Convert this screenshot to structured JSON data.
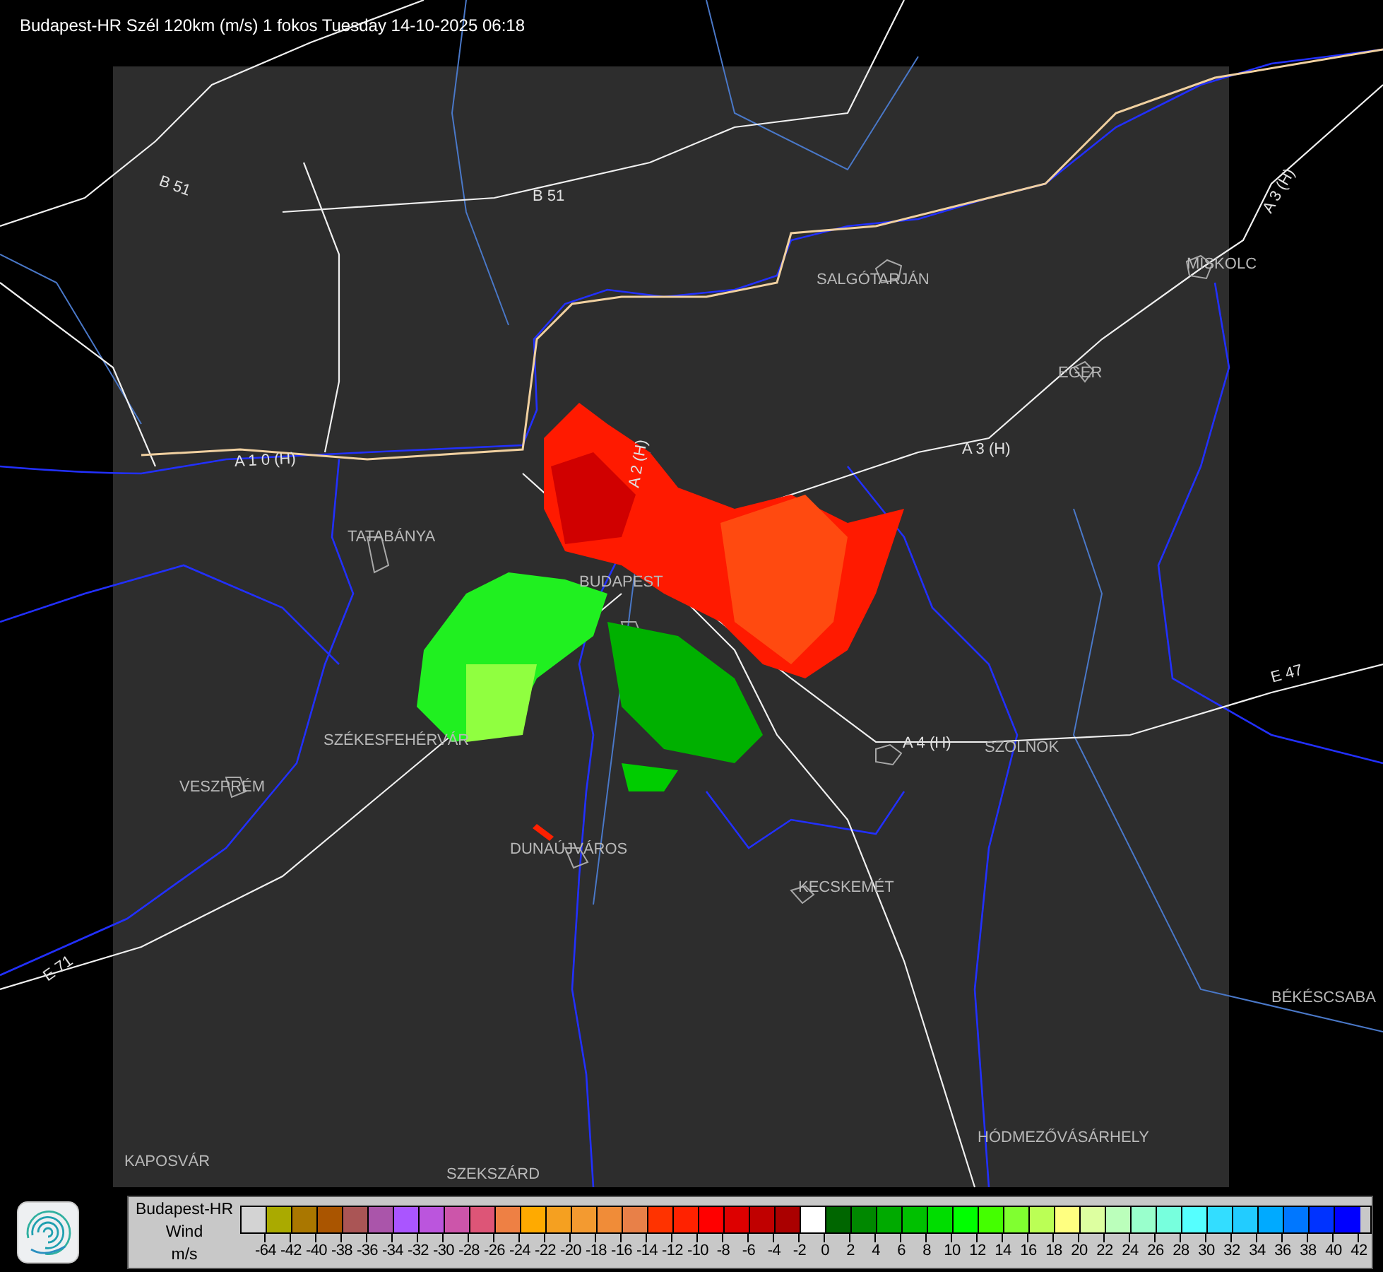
{
  "title": "Budapest-HR Szél 120km (m/s) 1 fokos Tuesday 14-10-2025 06:18",
  "map_labels": [
    {
      "kind": "road",
      "text": "B 51"
    },
    {
      "kind": "road",
      "text": "B 51"
    },
    {
      "kind": "city",
      "text": "SALGÓTARJÁN"
    },
    {
      "kind": "city",
      "text": "MISKOLC"
    },
    {
      "kind": "road",
      "text": "A 3 (H)"
    },
    {
      "kind": "road",
      "text": "A 3 (H)"
    },
    {
      "kind": "city",
      "text": "EGER"
    },
    {
      "kind": "road",
      "text": "A 1 0 (H)"
    },
    {
      "kind": "road",
      "text": "A 2 (H)"
    },
    {
      "kind": "city",
      "text": "TATABÁNYA"
    },
    {
      "kind": "city",
      "text": "BUDAPEST"
    },
    {
      "kind": "city",
      "text": "SZÉKESFEHÉRVÁR"
    },
    {
      "kind": "road",
      "text": "A 4 (H)"
    },
    {
      "kind": "city",
      "text": "SZOLNOK"
    },
    {
      "kind": "road",
      "text": "E 47"
    },
    {
      "kind": "city",
      "text": "VESZPRÉM"
    },
    {
      "kind": "city",
      "text": "DUNAÚJVÁROS"
    },
    {
      "kind": "city",
      "text": "KECSKEMÉT"
    },
    {
      "kind": "road",
      "text": "E 71"
    },
    {
      "kind": "city",
      "text": "BÉKÉSCSABA"
    },
    {
      "kind": "city",
      "text": "HÓDMEZŐVÁSÁRHELY"
    },
    {
      "kind": "city",
      "text": "KAPOSVÁR"
    },
    {
      "kind": "city",
      "text": "SZEKSZÁRD"
    }
  ],
  "legend": {
    "lines": [
      "Budapest-HR",
      "Wind",
      "m/s"
    ],
    "scale": [
      {
        "color": "#d3d3d3",
        "label": "-64"
      },
      {
        "color": "#aaaa00",
        "label": "-42"
      },
      {
        "color": "#aa7700",
        "label": "-40"
      },
      {
        "color": "#aa5500",
        "label": "-38"
      },
      {
        "color": "#aa5555",
        "label": "-36"
      },
      {
        "color": "#aa55aa",
        "label": "-34"
      },
      {
        "color": "#aa55ff",
        "label": "-32"
      },
      {
        "color": "#bb55dd",
        "label": "-30"
      },
      {
        "color": "#cc55aa",
        "label": "-28"
      },
      {
        "color": "#dd5577",
        "label": "-26"
      },
      {
        "color": "#ee8044",
        "label": "-24"
      },
      {
        "color": "#ffaa00",
        "label": "-22"
      },
      {
        "color": "#f5a020",
        "label": "-20"
      },
      {
        "color": "#f39a30",
        "label": "-18"
      },
      {
        "color": "#f08c38",
        "label": "-16"
      },
      {
        "color": "#e88048",
        "label": "-14"
      },
      {
        "color": "#ff3300",
        "label": "-12"
      },
      {
        "color": "#ff2200",
        "label": "-10"
      },
      {
        "color": "#ff0000",
        "label": "-8"
      },
      {
        "color": "#dd0000",
        "label": "-6"
      },
      {
        "color": "#c00000",
        "label": "-4"
      },
      {
        "color": "#aa0000",
        "label": "-2"
      },
      {
        "color": "#ffffff",
        "label": "0"
      },
      {
        "color": "#006600",
        "label": "2"
      },
      {
        "color": "#008800",
        "label": "4"
      },
      {
        "color": "#00aa00",
        "label": "6"
      },
      {
        "color": "#00c000",
        "label": "8"
      },
      {
        "color": "#00dd00",
        "label": "10"
      },
      {
        "color": "#00ff00",
        "label": "12"
      },
      {
        "color": "#44ff00",
        "label": "14"
      },
      {
        "color": "#80ff30",
        "label": "16"
      },
      {
        "color": "#bbff55",
        "label": "18"
      },
      {
        "color": "#ffff80",
        "label": "20"
      },
      {
        "color": "#ddffa0",
        "label": "22"
      },
      {
        "color": "#bbffbb",
        "label": "24"
      },
      {
        "color": "#99ffcc",
        "label": "26"
      },
      {
        "color": "#77ffdd",
        "label": "28"
      },
      {
        "color": "#55ffff",
        "label": "30"
      },
      {
        "color": "#33ddff",
        "label": "32"
      },
      {
        "color": "#22ccff",
        "label": "34"
      },
      {
        "color": "#00aaff",
        "label": "36"
      },
      {
        "color": "#0077ff",
        "label": "38"
      },
      {
        "color": "#0033ff",
        "label": "40"
      },
      {
        "color": "#0000ff",
        "label": "42"
      }
    ]
  }
}
